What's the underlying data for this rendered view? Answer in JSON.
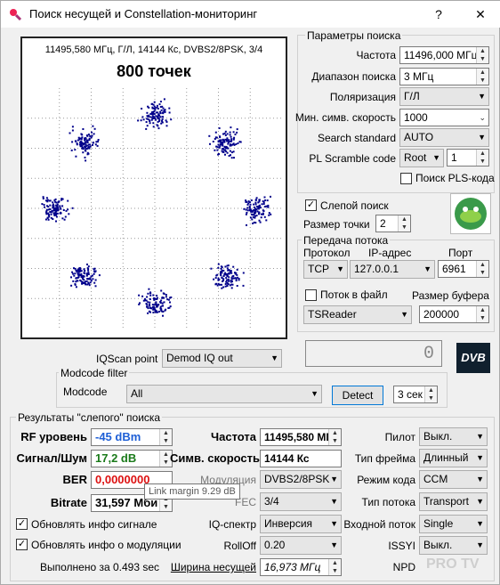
{
  "window": {
    "title": "Поиск несущей и Constellation-мониторинг",
    "help": "?",
    "close": "✕"
  },
  "plot": {
    "info_line": "11495,580 МГц, Г/Л, 14144 Кс, DVBS2/8PSK, 3/4",
    "points_label": "800 точек"
  },
  "chart_data": {
    "type": "scatter",
    "title": "800 точек",
    "series": [
      {
        "name": "8PSK constellation",
        "clusters": [
          {
            "x": 0,
            "y": 1
          },
          {
            "x": 0.707,
            "y": 0.707
          },
          {
            "x": 1,
            "y": 0
          },
          {
            "x": 0.707,
            "y": -0.707
          },
          {
            "x": 0,
            "y": -1
          },
          {
            "x": -0.707,
            "y": -0.707
          },
          {
            "x": -1,
            "y": 0
          },
          {
            "x": -0.707,
            "y": 0.707
          }
        ],
        "points_per_cluster": 100
      }
    ],
    "color": "#00008b"
  },
  "params": {
    "group_title": "Параметры поиска",
    "frequency_label": "Частота",
    "frequency_value": "11496,000 МГц",
    "range_label": "Диапазон поиска",
    "range_value": "3 МГц",
    "polarization_label": "Поляризация",
    "polarization_value": "Г/Л",
    "min_sr_label": "Мин. симв. скорость",
    "min_sr_value": "1000",
    "standard_label": "Search standard",
    "standard_value": "AUTO",
    "pls_label": "PL Scramble code",
    "pls_mode": "Root",
    "pls_value": "1",
    "pls_search_label": "Поиск PLS-кода"
  },
  "blind": {
    "blind_search_label": "Слепой поиск",
    "point_size_label": "Размер точки",
    "point_size_value": "2"
  },
  "stream": {
    "group_title": "Передача потока",
    "protocol_label": "Протокол",
    "ip_label": "IP-адрес",
    "port_label": "Порт",
    "protocol_value": "TCP",
    "ip_value": "127.0.0.1",
    "port_value": "6961",
    "to_file_label": "Поток в файл",
    "buffer_label": "Размер буфера",
    "reader_value": "TSReader",
    "buffer_value": "200000"
  },
  "counter": {
    "value": "0"
  },
  "logo": {
    "text": "DVB"
  },
  "iqscan": {
    "label": "IQScan point",
    "value": "Demod IQ out"
  },
  "modcode": {
    "group_title": "Modcode filter",
    "label": "Modcode",
    "value": "All",
    "detect_label": "Detect",
    "interval_value": "3 сек"
  },
  "results": {
    "group_title": "Результаты \"слепого\" поиска",
    "rf_label": "RF уровень",
    "rf_value": "-45 dBm",
    "snr_label": "Сигнал/Шум",
    "snr_value": "17,2 dB",
    "ber_label": "BER",
    "ber_value": "0,0000000",
    "bitrate_label": "Bitrate",
    "bitrate_value": "31,597 Мби",
    "freq_label": "Частота",
    "freq_value": "11495,580 МГ",
    "sr_label": "Симв. скорость",
    "sr_value": "14144 Кс",
    "mod_label": "Модуляция",
    "mod_value": "DVBS2/8PSK",
    "fec_label": "FEC",
    "fec_value": "3/4",
    "iq_label": "IQ-спектр",
    "iq_value": "Инверсия",
    "rolloff_label": "RollOff",
    "rolloff_value": "0.20",
    "bw_label": "Ширина несущей",
    "bw_value": "16,973 МГц",
    "pilot_label": "Пилот",
    "pilot_value": "Выкл.",
    "frame_label": "Тип фрейма",
    "frame_value": "Длинный",
    "codemode_label": "Режим кода",
    "codemode_value": "CCM",
    "stream_type_label": "Тип потока",
    "stream_type_value": "Transport",
    "input_label": "Входной поток",
    "input_value": "Single",
    "issyi_label": "ISSYI",
    "issyi_value": "Выкл.",
    "npd_label": "NPD",
    "update_signal_label": "Обновлять инфо сигнале",
    "update_mod_label": "Обновлять инфо о модуляции",
    "done_label": "Выполнено за 0.493 sec"
  },
  "tooltip": {
    "text": "Link margin 9.29 dB"
  },
  "watermark": {
    "text": "PRO TV"
  }
}
